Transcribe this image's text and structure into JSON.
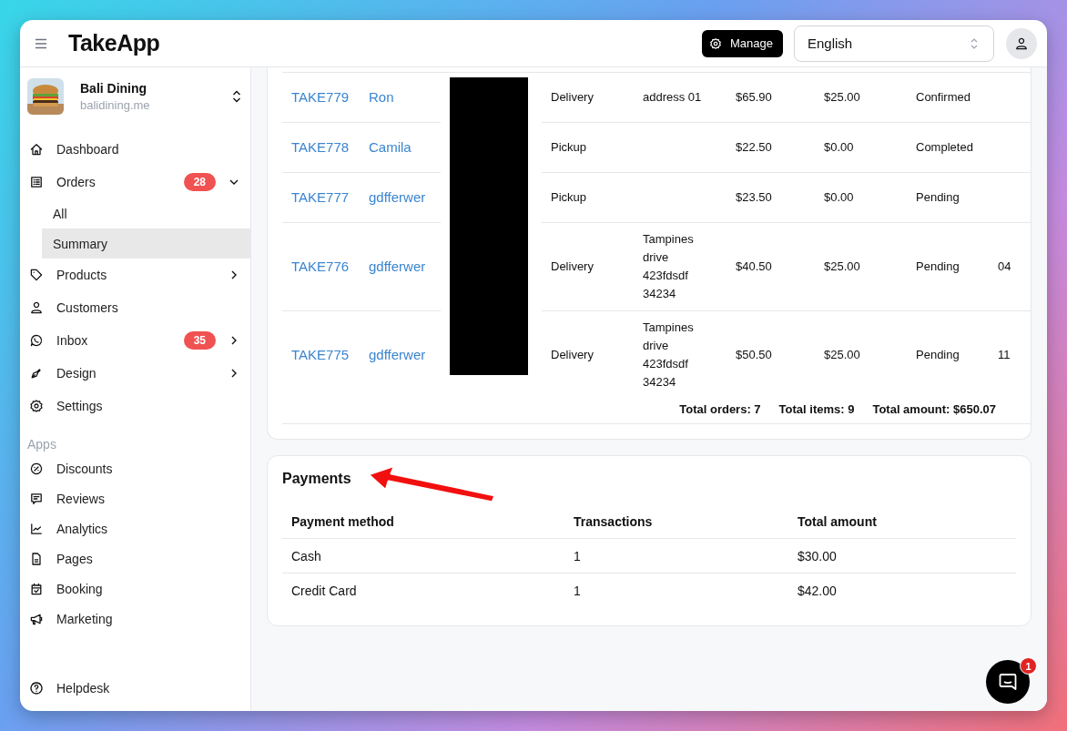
{
  "header": {
    "brand": "TakeApp",
    "manage_button": "Manage",
    "language": "English"
  },
  "sidebar": {
    "store": {
      "name": "Bali Dining",
      "domain": "balidining.me"
    },
    "nav": [
      {
        "label": "Dashboard",
        "selected": false
      },
      {
        "label": "Orders",
        "badge": "28",
        "expanded": true,
        "selected": false,
        "children": [
          {
            "label": "All",
            "selected": false
          },
          {
            "label": "Summary",
            "selected": true
          }
        ]
      },
      {
        "label": "Products",
        "expanded": false,
        "selected": false
      },
      {
        "label": "Customers",
        "selected": false
      },
      {
        "label": "Inbox",
        "badge": "35",
        "expanded": false,
        "selected": false
      },
      {
        "label": "Design",
        "expanded": false,
        "selected": false
      },
      {
        "label": "Settings",
        "selected": false
      }
    ],
    "apps_heading": "Apps",
    "apps": [
      {
        "label": "Discounts",
        "selected": false
      },
      {
        "label": "Reviews",
        "selected": false
      },
      {
        "label": "Analytics",
        "selected": false
      },
      {
        "label": "Pages",
        "selected": false
      },
      {
        "label": "Booking",
        "selected": false
      },
      {
        "label": "Marketing",
        "selected": false
      }
    ],
    "helpdesk": "Helpdesk"
  },
  "orders": {
    "rows": [
      {
        "order_id": "TAKE779",
        "customer": "Ron",
        "fulfillment": "Delivery",
        "address": "address 01",
        "column_6": "$65.90",
        "column_7": "$25.00",
        "status": "Confirmed"
      },
      {
        "order_id": "TAKE778",
        "customer": "Camila",
        "fulfillment": "Pickup",
        "column_6": "$22.50",
        "column_7": "$0.00",
        "status": "Completed"
      },
      {
        "order_id": "TAKE777",
        "customer": "gdfferwer",
        "fulfillment": "Pickup",
        "column_6": "$23.50",
        "column_7": "$0.00",
        "status": "Pending"
      },
      {
        "order_id": "TAKE776",
        "customer": "gdfferwer",
        "fulfillment": "Delivery",
        "address": "Tampines drive 423fdsdf 34234",
        "column_6": "$40.50",
        "column_7": "$25.00",
        "status": "Pending",
        "column_9": "04"
      },
      {
        "order_id": "TAKE775",
        "customer": "gdfferwer",
        "fulfillment": "Delivery",
        "address": "Tampines drive 423fdsdf 34234",
        "column_6": "$50.50",
        "column_7": "$25.00",
        "status": "Pending",
        "column_9": "11"
      }
    ],
    "totals": [
      "Total orders: 7",
      "Total items: 9",
      "Total amount: $650.07"
    ]
  },
  "payments": {
    "title": "Payments",
    "columns": [
      "Payment method",
      "Transactions",
      "Total amount"
    ],
    "rows": [
      {
        "method": "Cash",
        "transactions": "1",
        "total": "$30.00"
      },
      {
        "method": "Credit Card",
        "transactions": "1",
        "total": "$42.00"
      }
    ]
  },
  "chat": {
    "badge": "1"
  }
}
